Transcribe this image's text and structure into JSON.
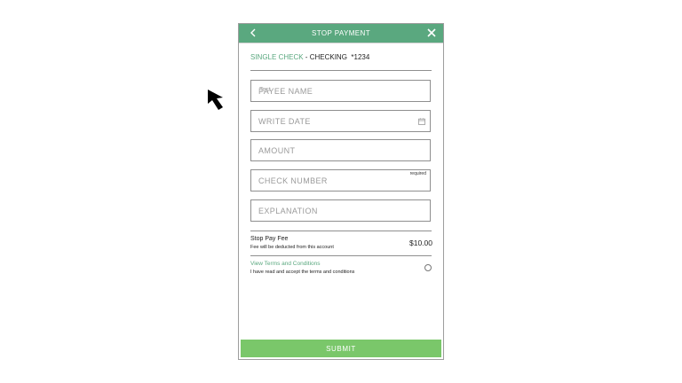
{
  "header": {
    "title": "STOP PAYMENT"
  },
  "account": {
    "type": "SINGLE CHECK",
    "separator": " - ",
    "name": "CHECKING",
    "number": "*1234"
  },
  "fields": {
    "payee": {
      "placeholder": "PAYEE NAME",
      "overlay": "Test"
    },
    "write_date": {
      "placeholder": "WRITE DATE"
    },
    "amount": {
      "placeholder": "AMOUNT"
    },
    "check_number": {
      "placeholder": "CHECK NUMBER",
      "required_label": "required"
    },
    "explanation": {
      "placeholder": "EXPLANATION"
    }
  },
  "fee": {
    "title": "Stop Pay Fee",
    "note": "Fee will be deducted from this account",
    "amount": "$10.00"
  },
  "terms": {
    "link": "View Terms and Conditions",
    "note": "I have read and accept the terms and conditions"
  },
  "submit": {
    "label": "SUBMIT"
  },
  "colors": {
    "accent": "#5aa87f",
    "submit": "#7ac76a"
  },
  "icons": {
    "back": "chevron-left-icon",
    "close": "close-icon",
    "calendar": "calendar-icon",
    "cursor": "mouse-pointer-icon"
  }
}
